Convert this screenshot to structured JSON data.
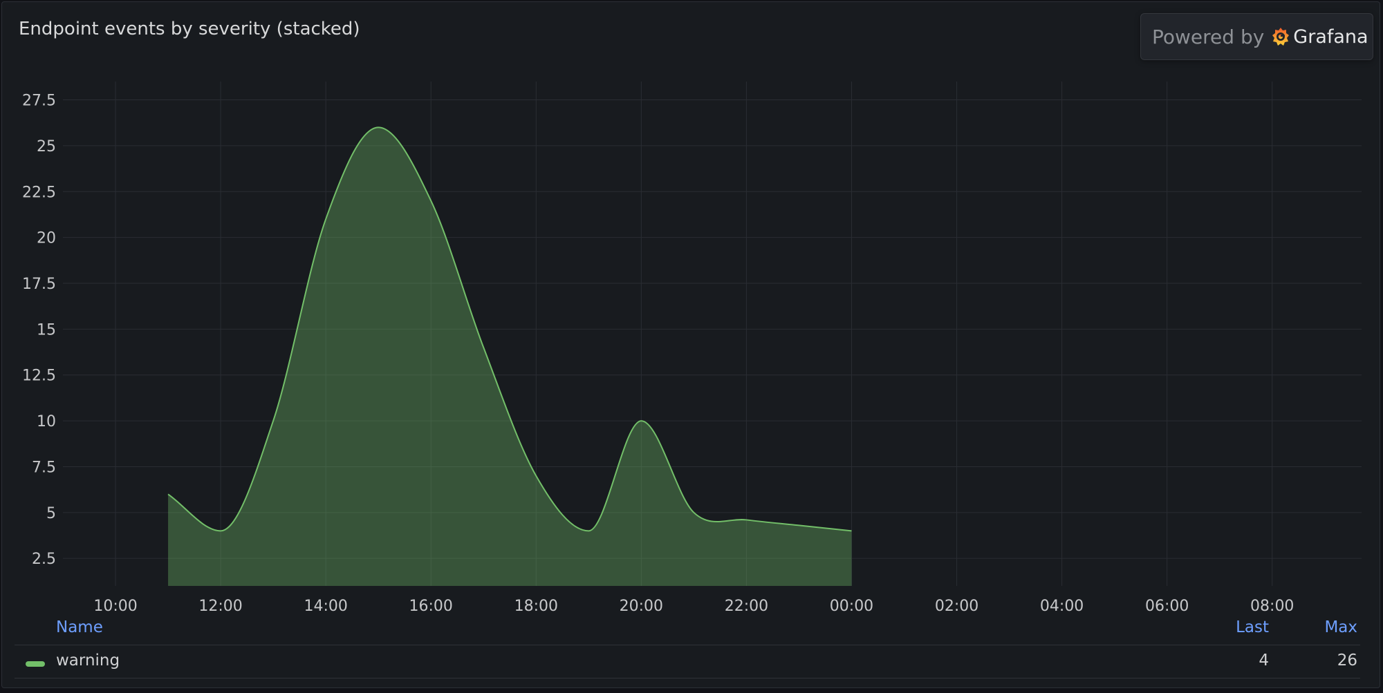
{
  "panel": {
    "title": "Endpoint events by severity (stacked)"
  },
  "powered_by": {
    "label": "Powered by",
    "brand": "Grafana"
  },
  "colors": {
    "series_line": "#73bf69",
    "series_fill": "#73bf69",
    "grid": "#2a2d33",
    "axis_text": "#c7c8ca",
    "legend_header": "#6e9fff"
  },
  "chart_data": {
    "type": "area",
    "title": "Endpoint events by severity (stacked)",
    "stacked": true,
    "grid": true,
    "legend_placement": "bottom",
    "y_ticks": [
      "2.5",
      "5",
      "7.5",
      "10",
      "12.5",
      "15",
      "17.5",
      "20",
      "22.5",
      "25",
      "27.5"
    ],
    "ylim": [
      1,
      28.5
    ],
    "x_ticks": [
      "10:00",
      "12:00",
      "14:00",
      "16:00",
      "18:00",
      "20:00",
      "22:00",
      "00:00",
      "02:00",
      "04:00",
      "06:00",
      "08:00"
    ],
    "x_unit": "hours since 10:00",
    "xlim": [
      -1,
      23.7
    ],
    "series": [
      {
        "name": "warning",
        "color": "#73bf69",
        "x": [
          1,
          2,
          3,
          4,
          5,
          6,
          7,
          8,
          9,
          10,
          11,
          12,
          13,
          14
        ],
        "values": [
          6,
          4,
          10,
          21,
          26,
          22,
          14,
          7,
          4,
          10,
          5,
          4.6,
          4.3,
          4
        ]
      }
    ]
  },
  "legend": {
    "headers": {
      "name": "Name",
      "last": "Last",
      "max": "Max"
    },
    "rows": [
      {
        "name": "warning",
        "last": "4",
        "max": "26"
      }
    ]
  }
}
